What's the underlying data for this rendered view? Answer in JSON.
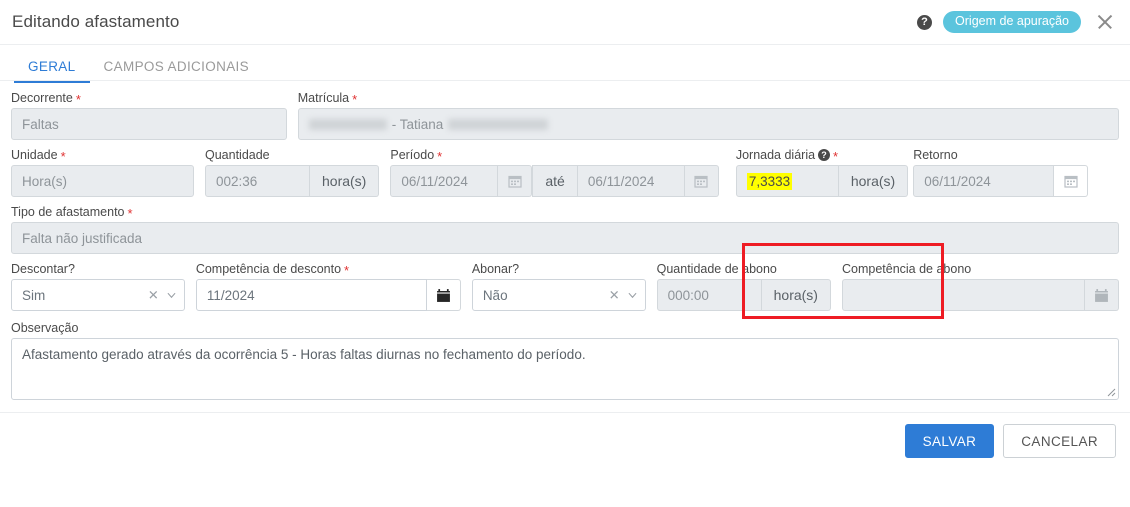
{
  "header": {
    "title": "Editando afastamento",
    "help_icon": "question-circle-icon",
    "badge": "Origem de apuração",
    "close_icon": "close-icon"
  },
  "tabs": [
    {
      "label": "GERAL",
      "active": true
    },
    {
      "label": "CAMPOS ADICIONAIS",
      "active": false
    }
  ],
  "fields": {
    "decorrente": {
      "label": "Decorrente",
      "required": "*",
      "value": "Faltas",
      "disabled": true
    },
    "matricula": {
      "label": "Matrícula",
      "required": "*",
      "value": "- Tatiana",
      "disabled": true,
      "redacted": true
    },
    "unidade": {
      "label": "Unidade",
      "required": "*",
      "value": "Hora(s)",
      "disabled": true
    },
    "quantidade": {
      "label": "Quantidade",
      "value": "002:36",
      "addon": "hora(s)",
      "disabled": true
    },
    "periodo": {
      "label": "Período",
      "required": "*",
      "start": "06/11/2024",
      "separator": "até",
      "end": "06/11/2024",
      "calendar_icon": "calendar-icon"
    },
    "jornada_diaria": {
      "label": "Jornada diária",
      "required": "*",
      "help_icon": "question-circle-icon",
      "value": "7,3333",
      "addon": "hora(s)",
      "highlighted": true,
      "emphasis_color": "#ee1c24",
      "highlight_color": "#ffff00"
    },
    "retorno": {
      "label": "Retorno",
      "value": "06/11/2024",
      "disabled": true,
      "calendar_icon": "calendar-icon"
    },
    "tipo_afastamento": {
      "label": "Tipo de afastamento",
      "required": "*",
      "value": "Falta não justificada",
      "disabled": true
    },
    "descontar": {
      "label": "Descontar?",
      "value": "Sim",
      "clear_icon": "clear-icon",
      "chevron_icon": "chevron-down-icon"
    },
    "competencia_desconto": {
      "label": "Competência de desconto",
      "required": "*",
      "value": "11/2024",
      "calendar_icon": "calendar-icon"
    },
    "abonar": {
      "label": "Abonar?",
      "value": "Não",
      "clear_icon": "clear-icon",
      "chevron_icon": "chevron-down-icon"
    },
    "quantidade_abono": {
      "label": "Quantidade de abono",
      "value": "000:00",
      "addon": "hora(s)",
      "disabled": true
    },
    "competencia_abono": {
      "label": "Competência de abono",
      "value": "",
      "disabled": true,
      "calendar_icon": "calendar-icon"
    },
    "observacao": {
      "label": "Observação",
      "value": "Afastamento gerado através da ocorrência 5 - Horas faltas diurnas no fechamento do período."
    }
  },
  "footer": {
    "save_label": "SALVAR",
    "cancel_label": "CANCELAR",
    "primary_color": "#2e7cd6"
  }
}
